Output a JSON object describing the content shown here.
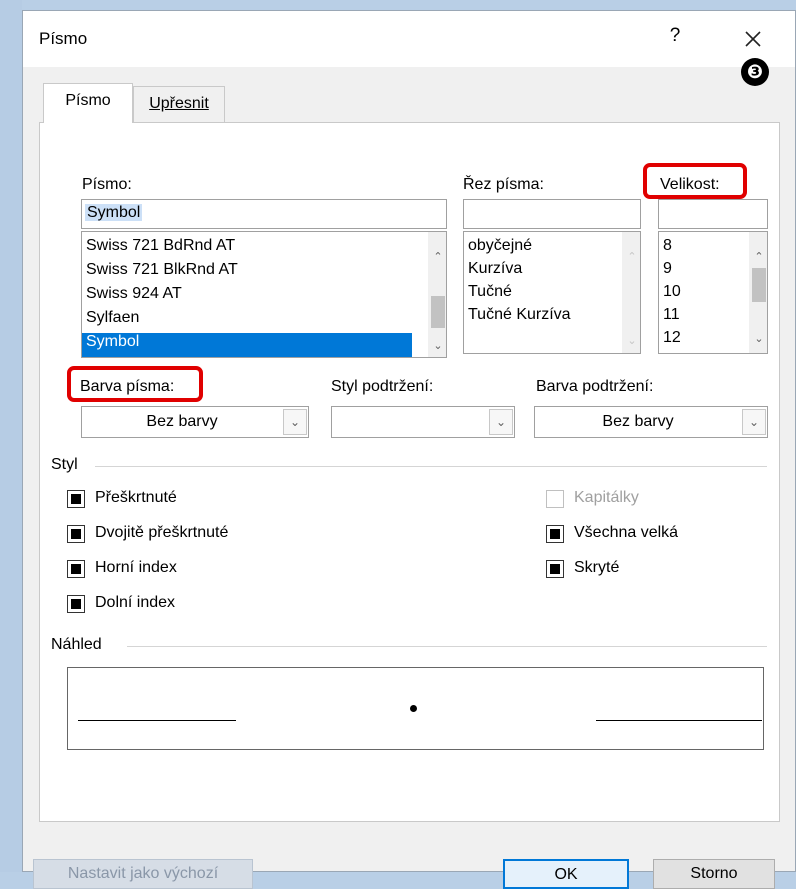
{
  "dialog": {
    "title": "Písmo",
    "help_label": "?",
    "callout_label": "❸"
  },
  "tabs": [
    {
      "label": "Písmo"
    },
    {
      "label": "Upřesnit"
    }
  ],
  "font": {
    "label": "Písmo:",
    "value": "Symbol",
    "list": [
      "Swiss 721 BdRnd AT",
      "Swiss 721 BlkRnd AT",
      "Swiss 924 AT",
      "Sylfaen",
      "Symbol"
    ]
  },
  "style": {
    "label": "Řez písma:",
    "value": "",
    "list": [
      "obyčejné",
      "Kurzíva",
      "Tučné",
      "Tučné Kurzíva"
    ]
  },
  "size": {
    "label": "Velikost:",
    "value": "",
    "list": [
      "8",
      "9",
      "10",
      "11",
      "12"
    ]
  },
  "font_color": {
    "label": "Barva písma:",
    "value": "Bez barvy"
  },
  "underline_style": {
    "label": "Styl podtržení:",
    "value": ""
  },
  "underline_color": {
    "label": "Barva podtržení:",
    "value": "Bez barvy"
  },
  "effects": {
    "group_label": "Styl",
    "items": [
      {
        "label": "Přeškrtnuté",
        "state": "indeterminate"
      },
      {
        "label": "Dvojitě přeškrtnuté",
        "state": "indeterminate"
      },
      {
        "label": "Horní index",
        "state": "indeterminate"
      },
      {
        "label": "Dolní index",
        "state": "indeterminate"
      },
      {
        "label": "Kapitálky",
        "state": "disabled"
      },
      {
        "label": "Všechna velká",
        "state": "indeterminate"
      },
      {
        "label": "Skryté",
        "state": "indeterminate"
      }
    ]
  },
  "preview": {
    "group_label": "Náhled"
  },
  "buttons": {
    "set_default": "Nastavit jako výchozí",
    "ok": "OK",
    "cancel": "Storno"
  },
  "colors": {
    "highlight": "#e00000",
    "selection": "#0078d7"
  }
}
